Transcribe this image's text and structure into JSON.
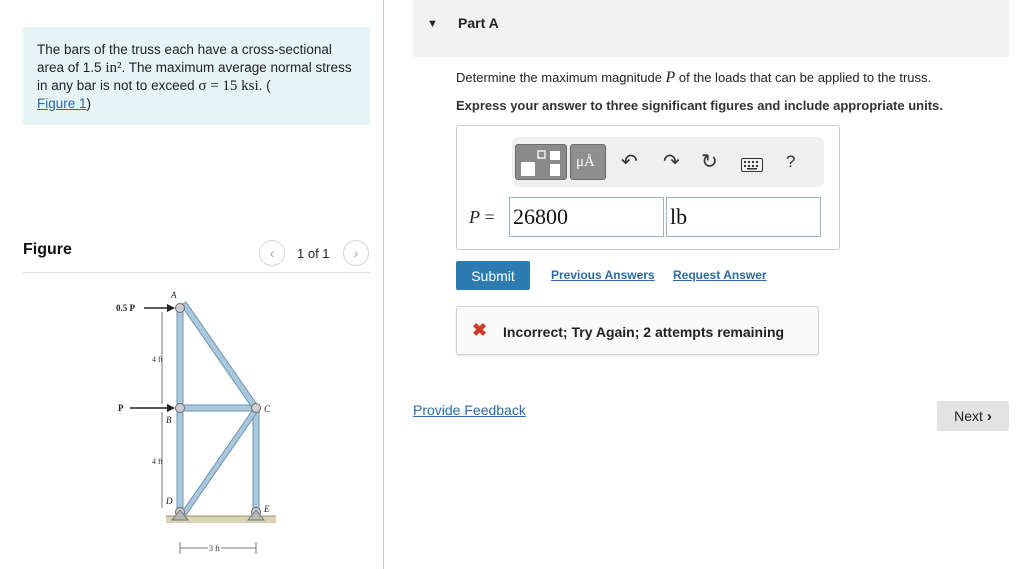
{
  "problem": {
    "text_before": "The bars of the truss each have a cross-sectional area of 1.5 ",
    "area_math": "in²",
    "text_middle": ". The maximum average normal stress in any bar is not to exceed ",
    "stress_math": "σ = 15 ksi",
    "text_after": ". (",
    "figure_link": "Figure 1",
    "close_paren": ")"
  },
  "figure": {
    "title": "Figure",
    "page_indicator": "1 of 1",
    "prev_icon": "chevron-left-icon",
    "next_icon": "chevron-right-icon",
    "labels": {
      "load_top": "0.5 P",
      "load_mid": "P",
      "node_a": "A",
      "node_b": "B",
      "node_c": "C",
      "node_d": "D",
      "node_e": "E",
      "dim_upper": "4 ft",
      "dim_lower": "4 ft",
      "dim_width": "3 ft"
    },
    "colors": {
      "member": "#a9c8de",
      "member_edge": "#6f94ae",
      "pin": "#9a9a9a"
    }
  },
  "part": {
    "toggle_icon": "caret-down-icon",
    "title": "Part A",
    "question_before": "Determine the maximum magnitude ",
    "question_var": "P",
    "question_after": " of the loads that can be applied to the truss.",
    "instruction": "Express your answer to three significant figures and include appropriate units."
  },
  "toolbar": {
    "icons": [
      "templates-icon",
      "units-icon",
      "undo-icon",
      "redo-icon",
      "reset-icon",
      "keyboard-icon",
      "help-icon"
    ],
    "units_glyph": "μÅ",
    "help_glyph": "?"
  },
  "answer": {
    "label_var": "P",
    "label_eq": " = ",
    "value": "26800",
    "unit": "lb"
  },
  "actions": {
    "submit": "Submit",
    "previous_answers": "Previous Answers",
    "request_answer": "Request Answer"
  },
  "feedback": {
    "icon": "x-icon",
    "message": "Incorrect; Try Again; 2 attempts remaining",
    "color": "#d13a2a"
  },
  "footer": {
    "provide_feedback": "Provide Feedback",
    "next": "Next"
  },
  "accent": "#2d7bb0"
}
